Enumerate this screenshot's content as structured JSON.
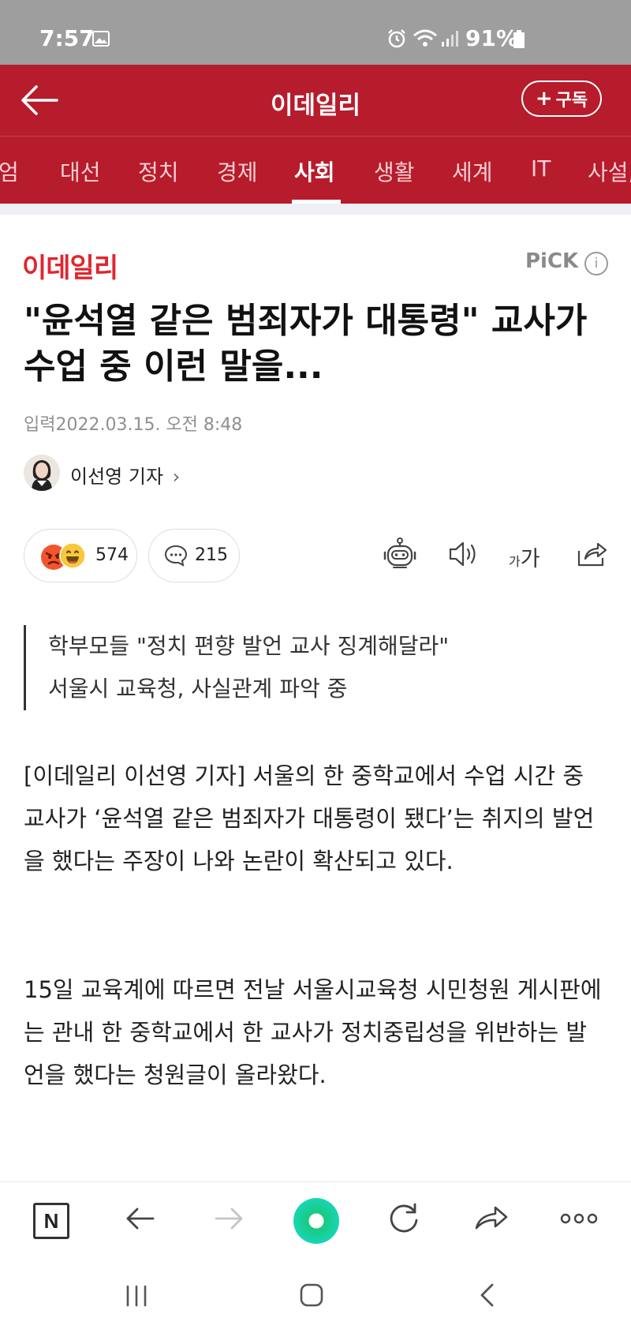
{
  "status_bar": {
    "time": "7:57",
    "battery": "91%"
  },
  "header": {
    "title": "이데일리",
    "subscribe_label": "구독",
    "subscribe_plus": "+"
  },
  "tabs": [
    {
      "label": "엄"
    },
    {
      "label": "대선"
    },
    {
      "label": "정치"
    },
    {
      "label": "경제"
    },
    {
      "label": "사회",
      "active": true
    },
    {
      "label": "생활"
    },
    {
      "label": "세계"
    },
    {
      "label": "IT"
    },
    {
      "label": "사설,"
    }
  ],
  "article": {
    "press_logo": "이데일리",
    "pick_label": "PiCK",
    "pick_info": "i",
    "headline": "\"윤석열 같은 범죄자가 대통령\" 교사가 수업 중 이런 말을...",
    "publish_time": "입력2022.03.15. 오전 8:48",
    "reporter": "이선영 기자",
    "reporter_chevron": "›",
    "reaction_count": "574",
    "comment_count": "215",
    "font_size_small": "가",
    "font_size_large": "가",
    "summary": [
      "학부모들 \"정치 편향 발언 교사 징계해달라\"",
      "서울시 교육청, 사실관계 파악 중"
    ],
    "paragraphs": [
      "[이데일리 이선영 기자] 서울의 한 중학교에서 수업 시간 중 교사가 ‘윤석열 같은 범죄자가 대통령이 됐다’는 취지의 발언을 했다는 주장이 나와 논란이 확산되고 있다.",
      "15일 교육계에 따르면 전날 서울시교육청 시민청원 게시판에는 관내 한 중학교에서 한 교사가 정치중립성을 위반하는 발언을 했다는 청원글이 올라왔다."
    ]
  },
  "toolbar": {
    "home_label": "N"
  },
  "colors": {
    "brand_red": "#b71c2c",
    "logo_red": "#e0262f",
    "green_button": "#19c97e"
  },
  "icons": [
    "back-arrow-icon",
    "alarm-icon",
    "wifi-icon",
    "signal-icon",
    "battery-icon",
    "robot-summary-icon",
    "speaker-icon",
    "share-icon",
    "comment-icon",
    "refresh-icon",
    "forward-icon",
    "more-icon"
  ]
}
